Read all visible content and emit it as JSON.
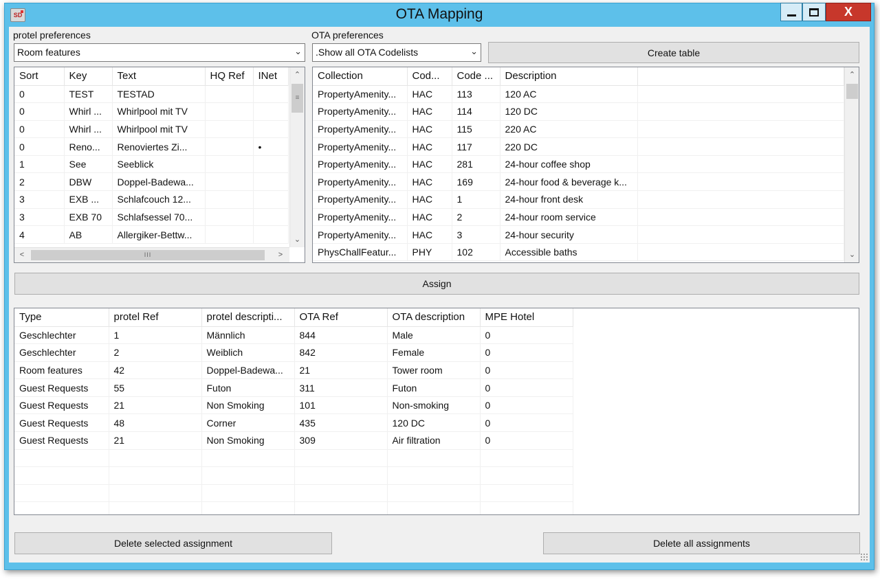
{
  "window": {
    "title": "OTA Mapping",
    "icon_text": "SD",
    "close_label": "X"
  },
  "protel": {
    "label": "protel preferences",
    "selected": "Room features",
    "columns": [
      "Sort",
      "Key",
      "Text",
      "HQ Ref",
      "INet"
    ],
    "rows": [
      [
        "0",
        "TEST",
        "TESTAD",
        "",
        ""
      ],
      [
        "0",
        "Whirl ...",
        "Whirlpool mit TV",
        "",
        ""
      ],
      [
        "0",
        "Whirl ...",
        "Whirlpool mit TV",
        "",
        ""
      ],
      [
        "0",
        "Reno...",
        "Renoviertes Zi...",
        "",
        "•"
      ],
      [
        "1",
        "See",
        "Seeblick",
        "",
        ""
      ],
      [
        "2",
        "DBW",
        "Doppel-Badewa...",
        "",
        ""
      ],
      [
        "3",
        "EXB ...",
        "Schlafcouch 12...",
        "",
        ""
      ],
      [
        "3",
        "EXB 70",
        "Schlafsessel 70...",
        "",
        ""
      ],
      [
        "4",
        "AB",
        "Allergiker-Bettw...",
        "",
        ""
      ]
    ],
    "hscroll_thumb": "III"
  },
  "ota": {
    "label": "OTA preferences",
    "selected": ".Show all OTA Codelists",
    "create_table_label": "Create table",
    "columns": [
      "Collection",
      "Cod...",
      "Code ...",
      "Description"
    ],
    "rows": [
      [
        "PropertyAmenity...",
        "HAC",
        "113",
        "120 AC"
      ],
      [
        "PropertyAmenity...",
        "HAC",
        "114",
        "120 DC"
      ],
      [
        "PropertyAmenity...",
        "HAC",
        "115",
        "220 AC"
      ],
      [
        "PropertyAmenity...",
        "HAC",
        "117",
        "220 DC"
      ],
      [
        "PropertyAmenity...",
        "HAC",
        "281",
        "24-hour coffee shop"
      ],
      [
        "PropertyAmenity...",
        "HAC",
        "169",
        "24-hour food & beverage k..."
      ],
      [
        "PropertyAmenity...",
        "HAC",
        "1",
        "24-hour front desk"
      ],
      [
        "PropertyAmenity...",
        "HAC",
        "2",
        "24-hour room service"
      ],
      [
        "PropertyAmenity...",
        "HAC",
        "3",
        "24-hour security"
      ],
      [
        "PhysChallFeatur...",
        "PHY",
        "102",
        "Accessible baths"
      ]
    ]
  },
  "assign_label": "Assign",
  "assignments": {
    "columns": [
      "Type",
      "protel Ref",
      "protel descripti...",
      "OTA Ref",
      "OTA description",
      "MPE Hotel"
    ],
    "rows": [
      [
        "Geschlechter",
        "1",
        "Männlich",
        "844",
        "Male",
        "0"
      ],
      [
        "Geschlechter",
        "2",
        "Weiblich",
        "842",
        "Female",
        "0"
      ],
      [
        "Room features",
        "42",
        "Doppel-Badewa...",
        "21",
        "Tower room",
        "0"
      ],
      [
        "Guest Requests",
        "55",
        "Futon",
        "311",
        "Futon",
        "0"
      ],
      [
        "Guest Requests",
        "21",
        "Non Smoking",
        "101",
        "Non-smoking",
        "0"
      ],
      [
        "Guest Requests",
        "48",
        "Corner",
        "435",
        "120 DC",
        "0"
      ],
      [
        "Guest Requests",
        "21",
        "Non Smoking",
        "309",
        "Air filtration",
        "0"
      ]
    ]
  },
  "delete_selected_label": "Delete selected assignment",
  "delete_all_label": "Delete all assignments"
}
